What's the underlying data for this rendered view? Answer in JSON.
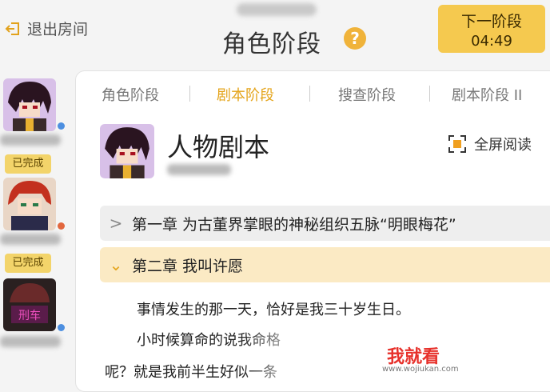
{
  "header": {
    "exit_label": "退出房间",
    "title": "角色阶段",
    "help_glyph": "?",
    "next_button_label": "下一阶段",
    "countdown": "04:49"
  },
  "sidebar": {
    "players": [
      {
        "done_label": "",
        "dot_color": "#4d8fe0"
      },
      {
        "done_label": "已完成",
        "dot_color": "#e2673e"
      },
      {
        "done_label": "已完成",
        "dot_color": "#4d8fe0"
      }
    ]
  },
  "tabs": [
    "角色阶段",
    "剧本阶段",
    "搜查阶段",
    "剧本阶段 II"
  ],
  "active_tab_index": 1,
  "script": {
    "title": "人物剧本",
    "fullscreen_label": "全屏阅读"
  },
  "chapters": [
    {
      "label": "第一章   为古董界掌眼的神秘组织五脉“明眼梅花”",
      "state": "collapsed"
    },
    {
      "label": "第二章   我叫许愿",
      "state": "expanded"
    }
  ],
  "content": {
    "line1": "事情发生的那一天，恰好是我三十岁生日。",
    "line2": "小时候算命的说我命格",
    "line3": "呢？就是我前半生好似一条"
  },
  "watermark": {
    "brand": "我就看",
    "url": "www.wojiukan.com"
  },
  "colors": {
    "accent": "#f5c94f",
    "active_tab": "#e4a41a",
    "done_badge": "#f3d46a"
  }
}
